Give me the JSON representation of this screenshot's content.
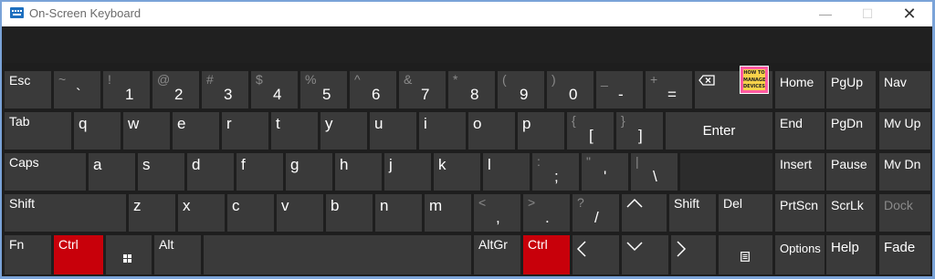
{
  "window": {
    "title": "On-Screen Keyboard",
    "icons": {
      "app": "keyboard-icon",
      "minimize": "minimize-icon",
      "maximize": "maximize-icon",
      "close": "close-icon"
    }
  },
  "logo": {
    "line1": "HOW TO",
    "line2": "MANAGE",
    "line3": "DEVICES"
  },
  "keys": {
    "esc": "Esc",
    "backquote": {
      "top": "~",
      "bottom": "`"
    },
    "d1": {
      "top": "!",
      "bottom": "1"
    },
    "d2": {
      "top": "@",
      "bottom": "2"
    },
    "d3": {
      "top": "#",
      "bottom": "3"
    },
    "d4": {
      "top": "$",
      "bottom": "4"
    },
    "d5": {
      "top": "%",
      "bottom": "5"
    },
    "d6": {
      "top": "^",
      "bottom": "6"
    },
    "d7": {
      "top": "&",
      "bottom": "7"
    },
    "d8": {
      "top": "*",
      "bottom": "8"
    },
    "d9": {
      "top": "(",
      "bottom": "9"
    },
    "d0": {
      "top": ")",
      "bottom": "0"
    },
    "minus": {
      "top": "_",
      "bottom": "-"
    },
    "equals": {
      "top": "+",
      "bottom": "="
    },
    "backspace_icon": "backspace-icon",
    "home": "Home",
    "pgup": "PgUp",
    "nav": "Nav",
    "tab": "Tab",
    "q": "q",
    "w": "w",
    "e": "e",
    "r": "r",
    "t": "t",
    "y": "y",
    "u": "u",
    "i": "i",
    "o": "o",
    "p": "p",
    "lbracket": {
      "top": "{",
      "bottom": "["
    },
    "rbracket": {
      "top": "}",
      "bottom": "]"
    },
    "enter": "Enter",
    "end": "End",
    "pgdn": "PgDn",
    "mvup": "Mv Up",
    "caps": "Caps",
    "a": "a",
    "s": "s",
    "d": "d",
    "f": "f",
    "g": "g",
    "h": "h",
    "j": "j",
    "k": "k",
    "l": "l",
    "semicolon": {
      "top": ":",
      "bottom": ";"
    },
    "quote": {
      "top": "\"",
      "bottom": "'"
    },
    "backslash": {
      "top": "|",
      "bottom": "\\"
    },
    "insert": "Insert",
    "pause": "Pause",
    "mvdn": "Mv Dn",
    "shift": "Shift",
    "z": "z",
    "x": "x",
    "c": "c",
    "v": "v",
    "b": "b",
    "n": "n",
    "m": "m",
    "comma": {
      "top": "<",
      "bottom": ","
    },
    "period": {
      "top": ">",
      "bottom": "."
    },
    "slash": {
      "top": "?",
      "bottom": "/"
    },
    "up_icon": "arrow-up-icon",
    "rshift": "Shift",
    "del": "Del",
    "prtscn": "PrtScn",
    "scrlk": "ScrLk",
    "dock": "Dock",
    "fn": "Fn",
    "ctrl": "Ctrl",
    "win_icon": "windows-icon",
    "alt": "Alt",
    "altgr": "AltGr",
    "rctrl": "Ctrl",
    "left_icon": "arrow-left-icon",
    "down_icon": "arrow-down-icon",
    "right_icon": "arrow-right-icon",
    "menu_icon": "context-menu-icon",
    "options": "Options",
    "help": "Help",
    "fade": "Fade"
  },
  "colors": {
    "key": "#3a3a3a",
    "background": "#1e1e1e",
    "active_modifier": "#c8000a",
    "dimmed_text": "#8a8a8a"
  }
}
